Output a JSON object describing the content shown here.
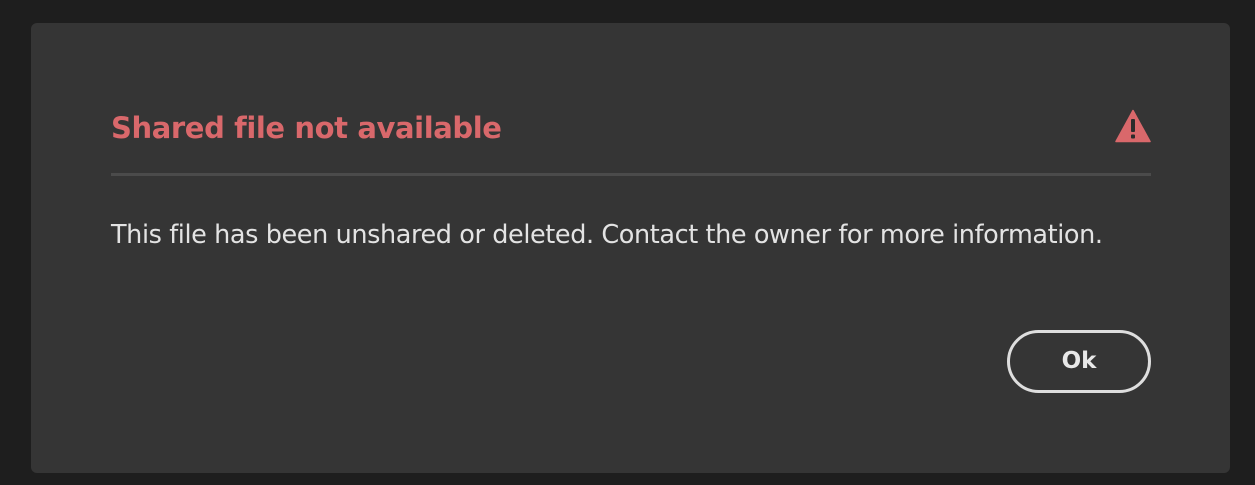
{
  "dialog": {
    "title": "Shared file not available",
    "icon": "alert-triangle-icon",
    "message": "This file has been unshared or deleted. Contact the owner for more information.",
    "ok_label": "Ok"
  },
  "colors": {
    "background": "#1e1e1e",
    "dialog_background": "#353535",
    "title": "#d9686b",
    "icon": "#d9686b",
    "message": "#e3e3e3",
    "button_border": "#dedede",
    "divider": "#4b4b4b"
  }
}
